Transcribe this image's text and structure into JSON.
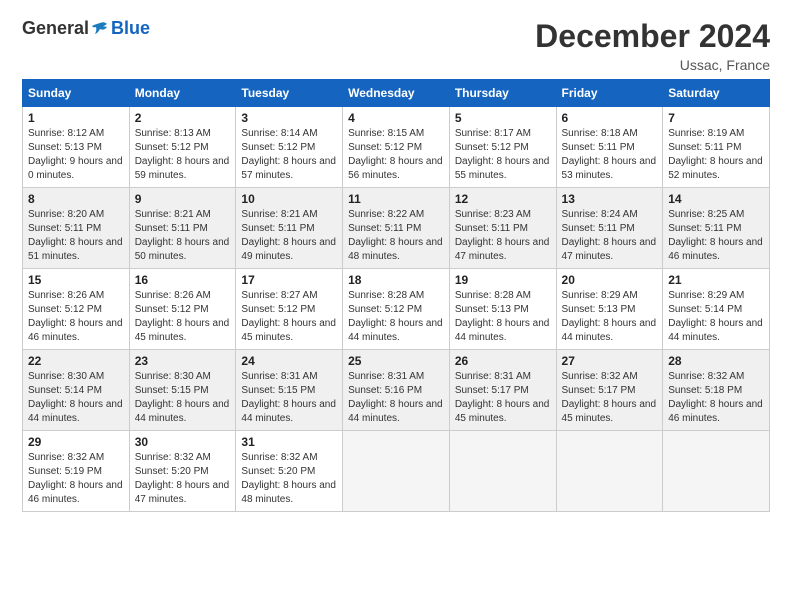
{
  "header": {
    "logo_general": "General",
    "logo_blue": "Blue",
    "month_title": "December 2024",
    "location": "Ussac, France"
  },
  "days_of_week": [
    "Sunday",
    "Monday",
    "Tuesday",
    "Wednesday",
    "Thursday",
    "Friday",
    "Saturday"
  ],
  "weeks": [
    [
      {
        "day": "1",
        "sunrise": "Sunrise: 8:12 AM",
        "sunset": "Sunset: 5:13 PM",
        "daylight": "Daylight: 9 hours and 0 minutes."
      },
      {
        "day": "2",
        "sunrise": "Sunrise: 8:13 AM",
        "sunset": "Sunset: 5:12 PM",
        "daylight": "Daylight: 8 hours and 59 minutes."
      },
      {
        "day": "3",
        "sunrise": "Sunrise: 8:14 AM",
        "sunset": "Sunset: 5:12 PM",
        "daylight": "Daylight: 8 hours and 57 minutes."
      },
      {
        "day": "4",
        "sunrise": "Sunrise: 8:15 AM",
        "sunset": "Sunset: 5:12 PM",
        "daylight": "Daylight: 8 hours and 56 minutes."
      },
      {
        "day": "5",
        "sunrise": "Sunrise: 8:17 AM",
        "sunset": "Sunset: 5:12 PM",
        "daylight": "Daylight: 8 hours and 55 minutes."
      },
      {
        "day": "6",
        "sunrise": "Sunrise: 8:18 AM",
        "sunset": "Sunset: 5:11 PM",
        "daylight": "Daylight: 8 hours and 53 minutes."
      },
      {
        "day": "7",
        "sunrise": "Sunrise: 8:19 AM",
        "sunset": "Sunset: 5:11 PM",
        "daylight": "Daylight: 8 hours and 52 minutes."
      }
    ],
    [
      {
        "day": "8",
        "sunrise": "Sunrise: 8:20 AM",
        "sunset": "Sunset: 5:11 PM",
        "daylight": "Daylight: 8 hours and 51 minutes."
      },
      {
        "day": "9",
        "sunrise": "Sunrise: 8:21 AM",
        "sunset": "Sunset: 5:11 PM",
        "daylight": "Daylight: 8 hours and 50 minutes."
      },
      {
        "day": "10",
        "sunrise": "Sunrise: 8:21 AM",
        "sunset": "Sunset: 5:11 PM",
        "daylight": "Daylight: 8 hours and 49 minutes."
      },
      {
        "day": "11",
        "sunrise": "Sunrise: 8:22 AM",
        "sunset": "Sunset: 5:11 PM",
        "daylight": "Daylight: 8 hours and 48 minutes."
      },
      {
        "day": "12",
        "sunrise": "Sunrise: 8:23 AM",
        "sunset": "Sunset: 5:11 PM",
        "daylight": "Daylight: 8 hours and 47 minutes."
      },
      {
        "day": "13",
        "sunrise": "Sunrise: 8:24 AM",
        "sunset": "Sunset: 5:11 PM",
        "daylight": "Daylight: 8 hours and 47 minutes."
      },
      {
        "day": "14",
        "sunrise": "Sunrise: 8:25 AM",
        "sunset": "Sunset: 5:11 PM",
        "daylight": "Daylight: 8 hours and 46 minutes."
      }
    ],
    [
      {
        "day": "15",
        "sunrise": "Sunrise: 8:26 AM",
        "sunset": "Sunset: 5:12 PM",
        "daylight": "Daylight: 8 hours and 46 minutes."
      },
      {
        "day": "16",
        "sunrise": "Sunrise: 8:26 AM",
        "sunset": "Sunset: 5:12 PM",
        "daylight": "Daylight: 8 hours and 45 minutes."
      },
      {
        "day": "17",
        "sunrise": "Sunrise: 8:27 AM",
        "sunset": "Sunset: 5:12 PM",
        "daylight": "Daylight: 8 hours and 45 minutes."
      },
      {
        "day": "18",
        "sunrise": "Sunrise: 8:28 AM",
        "sunset": "Sunset: 5:12 PM",
        "daylight": "Daylight: 8 hours and 44 minutes."
      },
      {
        "day": "19",
        "sunrise": "Sunrise: 8:28 AM",
        "sunset": "Sunset: 5:13 PM",
        "daylight": "Daylight: 8 hours and 44 minutes."
      },
      {
        "day": "20",
        "sunrise": "Sunrise: 8:29 AM",
        "sunset": "Sunset: 5:13 PM",
        "daylight": "Daylight: 8 hours and 44 minutes."
      },
      {
        "day": "21",
        "sunrise": "Sunrise: 8:29 AM",
        "sunset": "Sunset: 5:14 PM",
        "daylight": "Daylight: 8 hours and 44 minutes."
      }
    ],
    [
      {
        "day": "22",
        "sunrise": "Sunrise: 8:30 AM",
        "sunset": "Sunset: 5:14 PM",
        "daylight": "Daylight: 8 hours and 44 minutes."
      },
      {
        "day": "23",
        "sunrise": "Sunrise: 8:30 AM",
        "sunset": "Sunset: 5:15 PM",
        "daylight": "Daylight: 8 hours and 44 minutes."
      },
      {
        "day": "24",
        "sunrise": "Sunrise: 8:31 AM",
        "sunset": "Sunset: 5:15 PM",
        "daylight": "Daylight: 8 hours and 44 minutes."
      },
      {
        "day": "25",
        "sunrise": "Sunrise: 8:31 AM",
        "sunset": "Sunset: 5:16 PM",
        "daylight": "Daylight: 8 hours and 44 minutes."
      },
      {
        "day": "26",
        "sunrise": "Sunrise: 8:31 AM",
        "sunset": "Sunset: 5:17 PM",
        "daylight": "Daylight: 8 hours and 45 minutes."
      },
      {
        "day": "27",
        "sunrise": "Sunrise: 8:32 AM",
        "sunset": "Sunset: 5:17 PM",
        "daylight": "Daylight: 8 hours and 45 minutes."
      },
      {
        "day": "28",
        "sunrise": "Sunrise: 8:32 AM",
        "sunset": "Sunset: 5:18 PM",
        "daylight": "Daylight: 8 hours and 46 minutes."
      }
    ],
    [
      {
        "day": "29",
        "sunrise": "Sunrise: 8:32 AM",
        "sunset": "Sunset: 5:19 PM",
        "daylight": "Daylight: 8 hours and 46 minutes."
      },
      {
        "day": "30",
        "sunrise": "Sunrise: 8:32 AM",
        "sunset": "Sunset: 5:20 PM",
        "daylight": "Daylight: 8 hours and 47 minutes."
      },
      {
        "day": "31",
        "sunrise": "Sunrise: 8:32 AM",
        "sunset": "Sunset: 5:20 PM",
        "daylight": "Daylight: 8 hours and 48 minutes."
      },
      null,
      null,
      null,
      null
    ]
  ]
}
